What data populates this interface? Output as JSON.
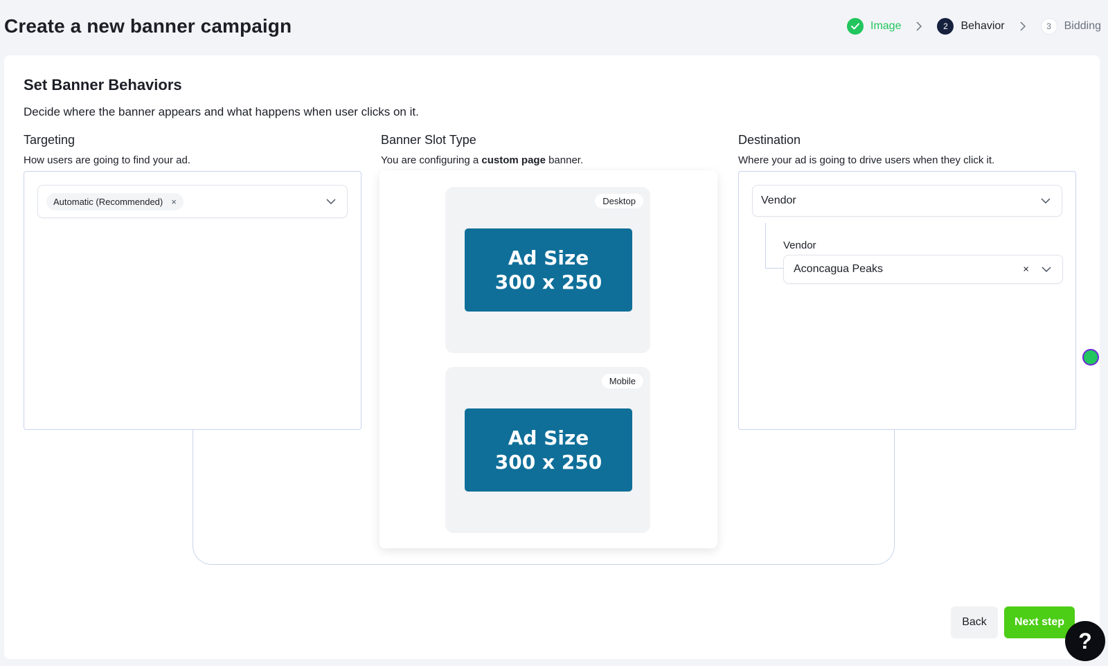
{
  "header": {
    "title": "Create a new banner campaign",
    "steps": [
      {
        "number": "",
        "label": "Image",
        "state": "done"
      },
      {
        "number": "2",
        "label": "Behavior",
        "state": "active"
      },
      {
        "number": "3",
        "label": "Bidding",
        "state": "upcoming"
      }
    ]
  },
  "main": {
    "title": "Set Banner Behaviors",
    "description": "Decide where the banner appears and what happens when user clicks on it."
  },
  "targeting": {
    "title": "Targeting",
    "subtitle": "How users are going to find your ad.",
    "selected_chip": "Automatic (Recommended)",
    "chip_remove": "×"
  },
  "slot": {
    "title": "Banner Slot Type",
    "subtitle_prefix": "You are configuring a",
    "subtitle_bold": "custom page",
    "subtitle_suffix": "banner.",
    "previews": [
      {
        "device": "Desktop",
        "line1": "Ad Size",
        "line2": "300 x 250"
      },
      {
        "device": "Mobile",
        "line1": "Ad Size",
        "line2": "300 x 250"
      }
    ]
  },
  "destination": {
    "title": "Destination",
    "subtitle": "Where your ad is going to drive users when they click it.",
    "type_value": "Vendor",
    "vendor_label": "Vendor",
    "vendor_value": "Aconcagua Peaks",
    "clear": "×"
  },
  "footer": {
    "back_label": "Back",
    "next_label": "Next step",
    "help_label": "?"
  },
  "colors": {
    "accent_green": "#4ccd16",
    "done_green": "#22c55e",
    "ad_blue": "#0f6f99",
    "active_step": "#16213e"
  }
}
